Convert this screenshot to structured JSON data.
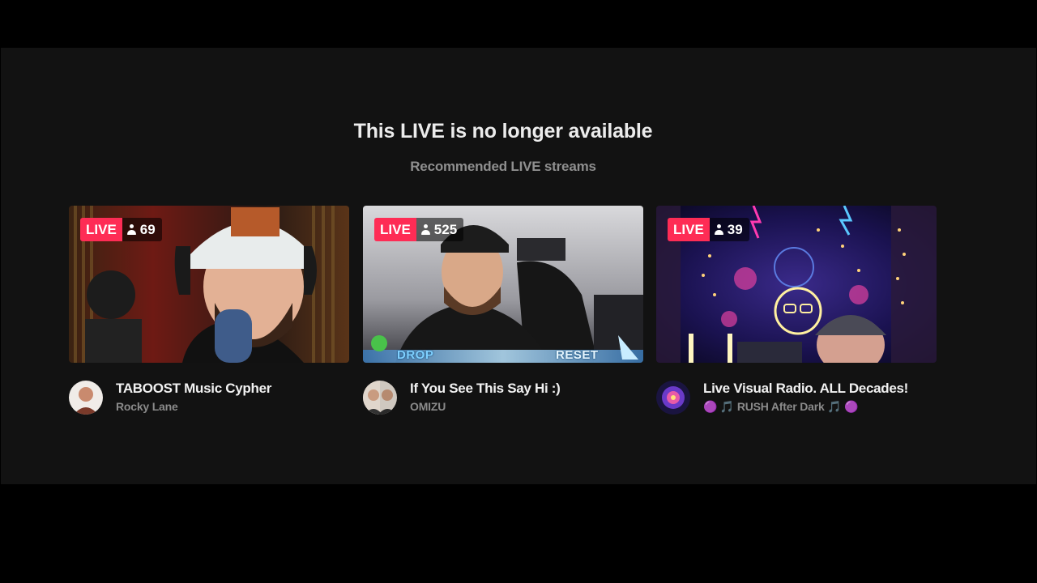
{
  "page": {
    "title": "This LIVE is no longer available",
    "subtitle": "Recommended LIVE streams"
  },
  "streams": [
    {
      "live_label": "LIVE",
      "viewers": "69",
      "title": "TABOOST Music Cypher",
      "channel": "Rocky Lane"
    },
    {
      "live_label": "LIVE",
      "viewers": "525",
      "title": "If You See This Say Hi :)",
      "channel": "OMIZU",
      "overlay": {
        "left": "DROP",
        "right": "RESET"
      }
    },
    {
      "live_label": "LIVE",
      "viewers": "39",
      "title": "Live Visual Radio. ALL Decades!",
      "channel": "🟣 🎵 RUSH After Dark 🎵 🟣"
    }
  ],
  "colors": {
    "live_badge": "#fe2c55",
    "panel_bg": "#121212",
    "page_bg": "#000000"
  },
  "icons": {
    "viewer": "person-icon"
  }
}
